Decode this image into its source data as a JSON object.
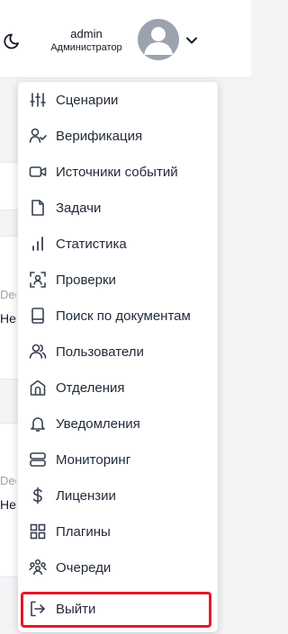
{
  "header": {
    "user_name": "admin",
    "user_role": "Администратор"
  },
  "background_fragments": {
    "grey_1": "Dee",
    "dark_1": "Не г",
    "grey_2": "Dee",
    "dark_2": "Не г"
  },
  "menu": {
    "items": [
      {
        "label": "Сценарии",
        "icon": "sliders-icon"
      },
      {
        "label": "Верификация",
        "icon": "user-check-icon"
      },
      {
        "label": "Источники событий",
        "icon": "video-camera-icon"
      },
      {
        "label": "Задачи",
        "icon": "document-icon"
      },
      {
        "label": "Статистика",
        "icon": "bar-chart-icon"
      },
      {
        "label": "Проверки",
        "icon": "face-scan-icon"
      },
      {
        "label": "Поиск по документам",
        "icon": "book-icon"
      },
      {
        "label": "Пользователи",
        "icon": "users-icon"
      },
      {
        "label": "Отделения",
        "icon": "building-icon"
      },
      {
        "label": "Уведомления",
        "icon": "bell-icon"
      },
      {
        "label": "Мониторинг",
        "icon": "server-icon"
      },
      {
        "label": "Лицензии",
        "icon": "dollar-icon"
      },
      {
        "label": "Плагины",
        "icon": "grid-icon"
      },
      {
        "label": "Очереди",
        "icon": "people-group-icon"
      },
      {
        "label": "Выйти",
        "icon": "logout-icon"
      }
    ],
    "highlight_color": "#e2192b"
  }
}
